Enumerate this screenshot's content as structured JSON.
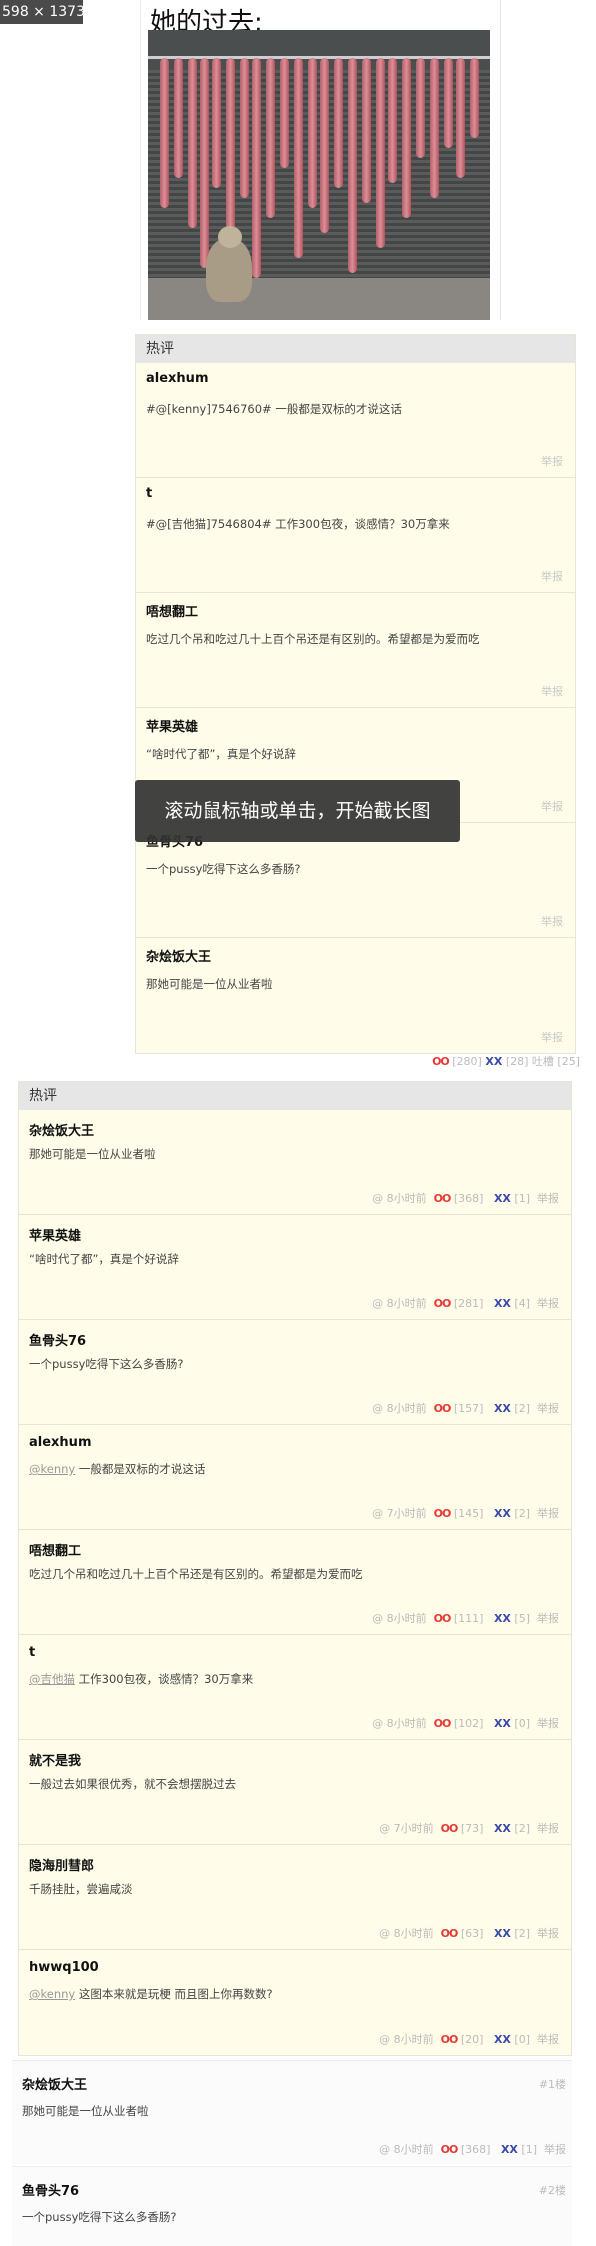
{
  "screenshot_badge": "598 × 1373",
  "post": {
    "title": "她的过去:"
  },
  "hot_top": {
    "header": "热评",
    "comments": [
      {
        "author": "alexhum",
        "text": "#@[kenny]7546760# 一般都是双标的才说这话",
        "report": "举报"
      },
      {
        "author": "t",
        "text": "#@[吉他猫]7546804# 工作300包夜，谈感情？30万拿来",
        "report": "举报"
      },
      {
        "author": "唔想翻工",
        "text": "吃过几个吊和吃过几十上百个吊还是有区别的。希望都是为爱而吃",
        "report": "举报"
      },
      {
        "author": "苹果英雄",
        "text": "“啥时代了都”，真是个好说辞",
        "report": "举报"
      },
      {
        "author": "鱼骨头76",
        "text": "一个pussy吃得下这么多香肠?",
        "report": "举报"
      },
      {
        "author": "杂烩饭大王",
        "text": "那她可能是一位从业者啦",
        "report": "举报"
      }
    ],
    "votes": {
      "oo": "OO",
      "oo_count": "[280]",
      "xx": "XX",
      "xx_count": "[28]",
      "tucao": "吐槽 [25]"
    }
  },
  "toast": "滚动鼠标轴或单击，开始截长图",
  "hot_list": {
    "header": "热评",
    "comments": [
      {
        "author": "杂烩饭大王",
        "mention": "",
        "text": "那她可能是一位从业者啦",
        "time": "@ 8小时前",
        "oo": "OO",
        "oo_count": "[368]",
        "xx": "XX",
        "xx_count": "[1]",
        "report": "举报"
      },
      {
        "author": "苹果英雄",
        "mention": "",
        "text": "“啥时代了都”，真是个好说辞",
        "time": "@ 8小时前",
        "oo": "OO",
        "oo_count": "[281]",
        "xx": "XX",
        "xx_count": "[4]",
        "report": "举报"
      },
      {
        "author": "鱼骨头76",
        "mention": "",
        "text": "一个pussy吃得下这么多香肠?",
        "time": "@ 8小时前",
        "oo": "OO",
        "oo_count": "[157]",
        "xx": "XX",
        "xx_count": "[2]",
        "report": "举报"
      },
      {
        "author": "alexhum",
        "mention": "@kenny",
        "text": " 一般都是双标的才说这话",
        "time": "@ 7小时前",
        "oo": "OO",
        "oo_count": "[145]",
        "xx": "XX",
        "xx_count": "[2]",
        "report": "举报"
      },
      {
        "author": "唔想翻工",
        "mention": "",
        "text": "吃过几个吊和吃过几十上百个吊还是有区别的。希望都是为爱而吃",
        "time": "@ 8小时前",
        "oo": "OO",
        "oo_count": "[111]",
        "xx": "XX",
        "xx_count": "[5]",
        "report": "举报"
      },
      {
        "author": "t",
        "mention": "@吉他猫",
        "text": " 工作300包夜，谈感情？30万拿来",
        "time": "@ 8小时前",
        "oo": "OO",
        "oo_count": "[102]",
        "xx": "XX",
        "xx_count": "[0]",
        "report": "举报"
      },
      {
        "author": "就不是我",
        "mention": "",
        "text": "一般过去如果很优秀，就不会想摆脱过去",
        "time": "@ 7小时前",
        "oo": "OO",
        "oo_count": "[73]",
        "xx": "XX",
        "xx_count": "[2]",
        "report": "举报"
      },
      {
        "author": "隐海刖彗郎",
        "mention": "",
        "text": "千肠挂肚，尝遍咸淡",
        "time": "@ 8小时前",
        "oo": "OO",
        "oo_count": "[63]",
        "xx": "XX",
        "xx_count": "[2]",
        "report": "举报"
      },
      {
        "author": "hwwq100",
        "mention": "@kenny",
        "text": " 这图本来就是玩梗 而且图上你再数数?",
        "time": "@ 8小时前",
        "oo": "OO",
        "oo_count": "[20]",
        "xx": "XX",
        "xx_count": "[0]",
        "report": "举报"
      }
    ]
  },
  "floor_comments": [
    {
      "author": "杂烩饭大王",
      "floor": "#1楼",
      "text": "那她可能是一位从业者啦",
      "time": "@ 8小时前",
      "oo": "OO",
      "oo_count": "[368]",
      "xx": "XX",
      "xx_count": "[1]",
      "report": "举报"
    },
    {
      "author": "鱼骨头76",
      "floor": "#2楼",
      "text": "一个pussy吃得下这么多香肠?",
      "time": "",
      "oo": "",
      "oo_count": "",
      "xx": "",
      "xx_count": "",
      "report": ""
    }
  ],
  "colors": {
    "oo": "#e53935",
    "xx": "#3949ab",
    "panel_bg": "#fffde9",
    "header_bg": "#e6e6e6"
  }
}
